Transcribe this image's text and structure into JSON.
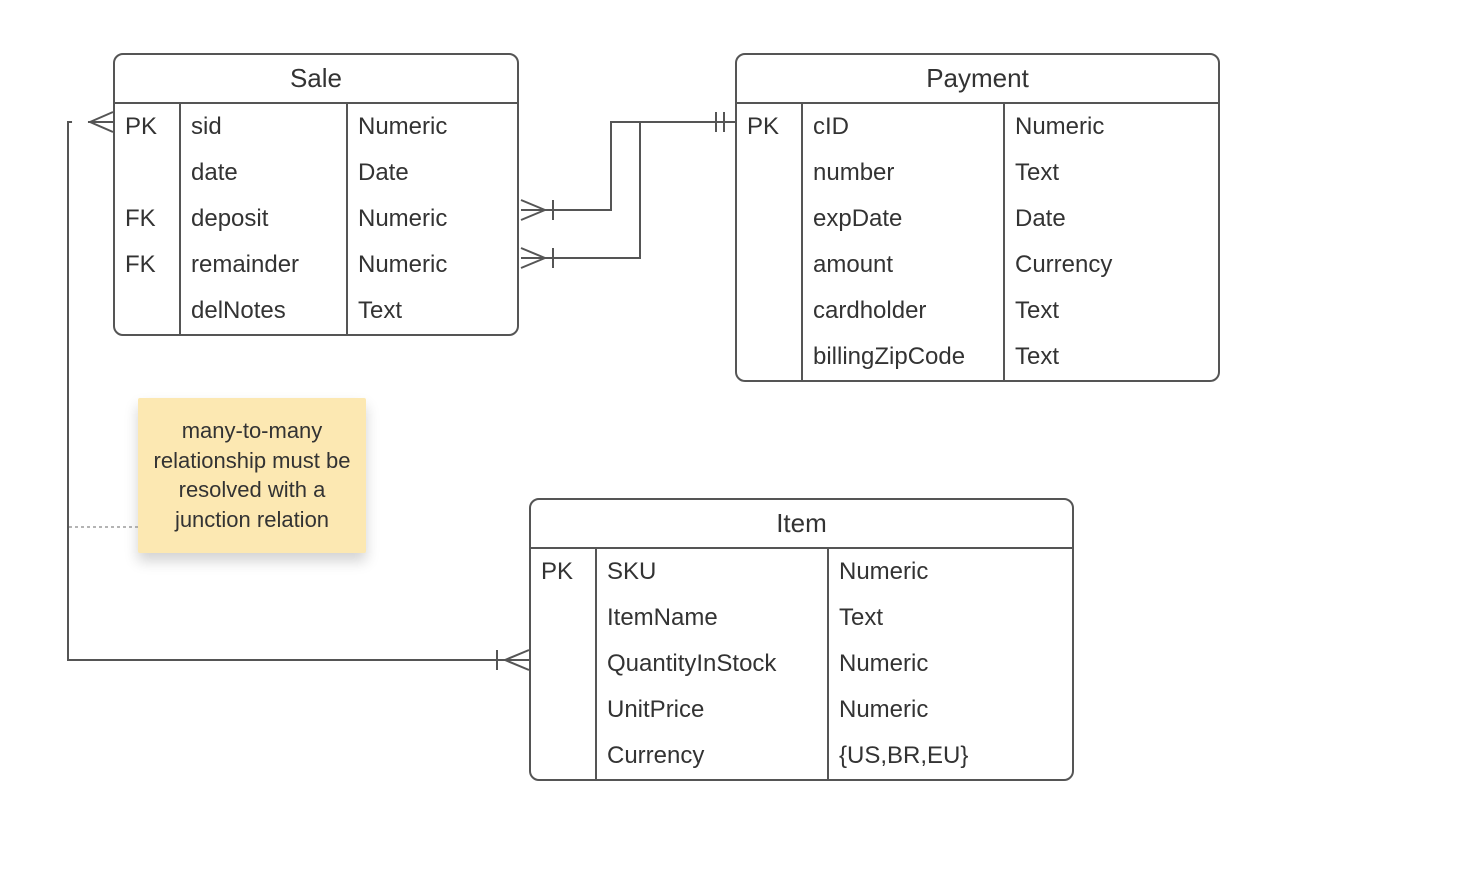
{
  "entities": {
    "sale": {
      "title": "Sale",
      "rows": [
        {
          "key": "PK",
          "name": "sid",
          "type": "Numeric"
        },
        {
          "key": "",
          "name": "date",
          "type": "Date"
        },
        {
          "key": "FK",
          "name": "deposit",
          "type": "Numeric"
        },
        {
          "key": "FK",
          "name": "remainder",
          "type": "Numeric"
        },
        {
          "key": "",
          "name": "delNotes",
          "type": "Text"
        }
      ]
    },
    "payment": {
      "title": "Payment",
      "rows": [
        {
          "key": "PK",
          "name": "cID",
          "type": "Numeric"
        },
        {
          "key": "",
          "name": "number",
          "type": "Text"
        },
        {
          "key": "",
          "name": "expDate",
          "type": "Date"
        },
        {
          "key": "",
          "name": "amount",
          "type": "Currency"
        },
        {
          "key": "",
          "name": "cardholder",
          "type": "Text"
        },
        {
          "key": "",
          "name": "billingZipCode",
          "type": "Text"
        }
      ]
    },
    "item": {
      "title": "Item",
      "rows": [
        {
          "key": "PK",
          "name": "SKU",
          "type": "Numeric"
        },
        {
          "key": "",
          "name": "ItemName",
          "type": "Text"
        },
        {
          "key": "",
          "name": "QuantityInStock",
          "type": "Numeric"
        },
        {
          "key": "",
          "name": "UnitPrice",
          "type": "Numeric"
        },
        {
          "key": "",
          "name": "Currency",
          "type": "{US,BR,EU}"
        }
      ]
    }
  },
  "note": {
    "text": "many-to-many relationship must be resolved with a junction relation"
  },
  "relationships": [
    {
      "from": "Sale.deposit",
      "to": "Payment.cID",
      "fromCard": "many-mandatory",
      "toCard": "one-mandatory"
    },
    {
      "from": "Sale.remainder",
      "to": "Payment.cID",
      "fromCard": "many-mandatory",
      "toCard": "one-mandatory"
    },
    {
      "from": "Sale",
      "to": "Item",
      "fromCard": "many-optional",
      "toCard": "many"
    }
  ]
}
